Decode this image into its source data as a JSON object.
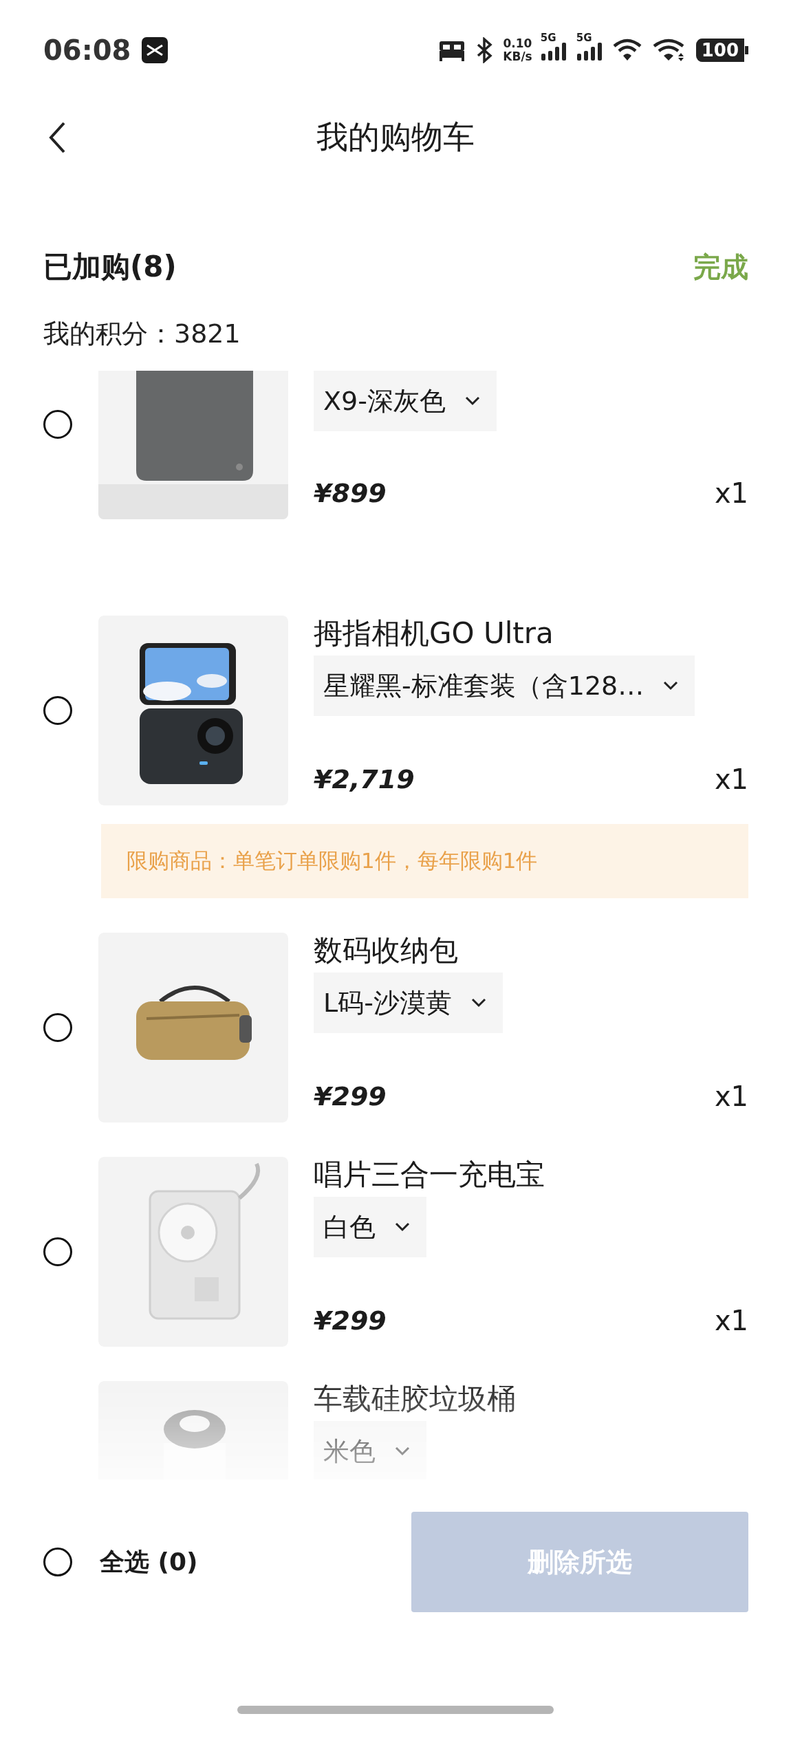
{
  "status_bar": {
    "time": "06:08",
    "net_speed": "0.10",
    "net_unit": "KB/s",
    "sim1": "5G",
    "sim2": "5G",
    "battery": "100"
  },
  "header": {
    "title": "我的购物车"
  },
  "summary": {
    "added": "已加购(8)",
    "done": "完成",
    "points": "我的积分：3821"
  },
  "items": [
    {
      "selected": false,
      "variant": "X9-深灰色",
      "price": "¥899",
      "quantity": "x1"
    },
    {
      "selected": false,
      "title": "拇指相机GO Ultra",
      "variant": "星耀黑-标准套装（含128…",
      "price": "¥2,719",
      "quantity": "x1",
      "notice": "限购商品：单笔订单限购1件，每年限购1件"
    },
    {
      "selected": false,
      "title": "数码收纳包",
      "variant": "L码-沙漠黄",
      "price": "¥299",
      "quantity": "x1"
    },
    {
      "selected": false,
      "title": "唱片三合一充电宝",
      "variant": "白色",
      "price": "¥299",
      "quantity": "x1"
    },
    {
      "title": "车载硅胶垃圾桶",
      "variant": "米色"
    }
  ],
  "footer": {
    "select_all": {
      "label": "全选 (0)",
      "selected": false
    },
    "delete_button": {
      "label": "删除所选",
      "disabled": true
    }
  }
}
